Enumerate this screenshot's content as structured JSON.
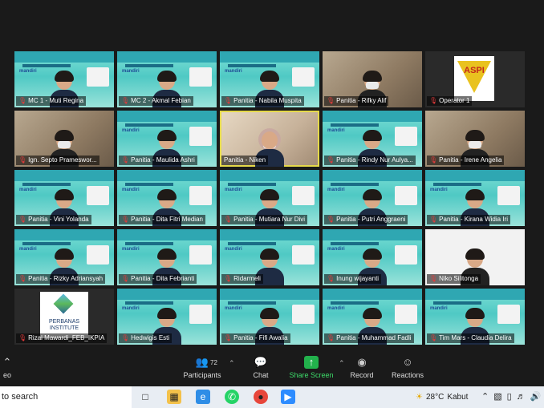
{
  "tiles": [
    {
      "name": "MC 1 - Muti Regina",
      "bg": "banner",
      "muted": true
    },
    {
      "name": "MC 2 - Akmal Febian",
      "bg": "banner",
      "muted": true
    },
    {
      "name": "Panitia - Nabila Muspita",
      "bg": "banner",
      "muted": true
    },
    {
      "name": "Panitia - Rifky Alif",
      "bg": "room",
      "muted": true
    },
    {
      "name": "Operator 1",
      "bg": "aspi",
      "muted": true
    },
    {
      "name": "Ign. Septo Prameswor...",
      "bg": "room",
      "muted": true
    },
    {
      "name": "Panitia - Maulida Ashri",
      "bg": "banner",
      "muted": true
    },
    {
      "name": "Panitia - Niken",
      "bg": "warm",
      "muted": false,
      "active": true
    },
    {
      "name": "Panitia - Rindy Nur Aulya...",
      "bg": "banner",
      "muted": true
    },
    {
      "name": "Panitia - Irene Angelia",
      "bg": "room",
      "muted": true
    },
    {
      "name": "Panitia - Vini Yolanda",
      "bg": "banner",
      "muted": true
    },
    {
      "name": "Panitia - Dita Fitri Median",
      "bg": "banner",
      "muted": true
    },
    {
      "name": "Panitia - Mutiara Nur Divi",
      "bg": "banner",
      "muted": true
    },
    {
      "name": "Panitia - Putri Anggraeni",
      "bg": "banner",
      "muted": true
    },
    {
      "name": "Panitia - Kirana Widia Iri",
      "bg": "banner",
      "muted": true
    },
    {
      "name": "Panitia - Rizky Adriansyah",
      "bg": "banner",
      "muted": true
    },
    {
      "name": "Panitia - Dita Febrianti",
      "bg": "banner",
      "muted": true
    },
    {
      "name": "Ridarmeli",
      "bg": "banner",
      "muted": true
    },
    {
      "name": "Inung wijayanti",
      "bg": "banner",
      "muted": true
    },
    {
      "name": "Niko Silitonga",
      "bg": "white",
      "muted": true
    },
    {
      "name": "Rizal Mawardi_FEB_IKPIA",
      "bg": "perbanas",
      "muted": true
    },
    {
      "name": "Hedwigis Esti",
      "bg": "banner",
      "muted": true
    },
    {
      "name": "Panitia - Fifi Awalia",
      "bg": "banner",
      "muted": true
    },
    {
      "name": "Panitia - Muhammad Fadli",
      "bg": "banner",
      "muted": true
    },
    {
      "name": "Tim Mars - Claudia Delira",
      "bg": "banner",
      "muted": true
    }
  ],
  "banner": {
    "brand": "mandiri"
  },
  "aspi": {
    "text": "ASPI"
  },
  "perbanas": {
    "text": "PERBANAS INSTITUTE"
  },
  "controls": {
    "left_label": "eo",
    "participants_label": "Participants",
    "participants_count": "72",
    "chat_label": "Chat",
    "share_label": "Share Screen",
    "record_label": "Record",
    "reactions_label": "Reactions"
  },
  "taskbar": {
    "search_placeholder": "to search",
    "weather_temp": "28°C",
    "weather_desc": "Kabut"
  }
}
